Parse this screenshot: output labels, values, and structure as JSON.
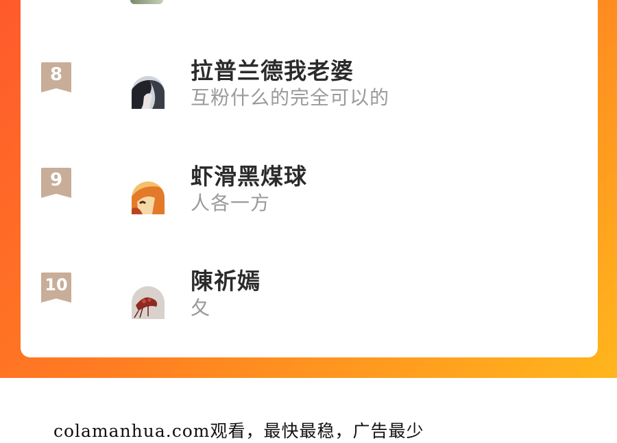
{
  "ranking": {
    "entries": [
      {
        "rank": "8",
        "name": "拉普兰德我老婆",
        "desc": "互粉什么的完全可以的",
        "avatar": "dark-hair-avatar"
      },
      {
        "rank": "9",
        "name": "虾滑黑煤球",
        "desc": "人各一方",
        "avatar": "orange-anime-avatar"
      },
      {
        "rank": "10",
        "name": "陳祈嫣",
        "desc": "夂",
        "avatar": "red-illustration-avatar"
      }
    ]
  },
  "footer": {
    "text": "colamanhua.com观看，最快最稳，广告最少"
  },
  "colors": {
    "gradient_start": "#ff5a2c",
    "gradient_end": "#ffb61c",
    "badge": "#c4a892"
  }
}
